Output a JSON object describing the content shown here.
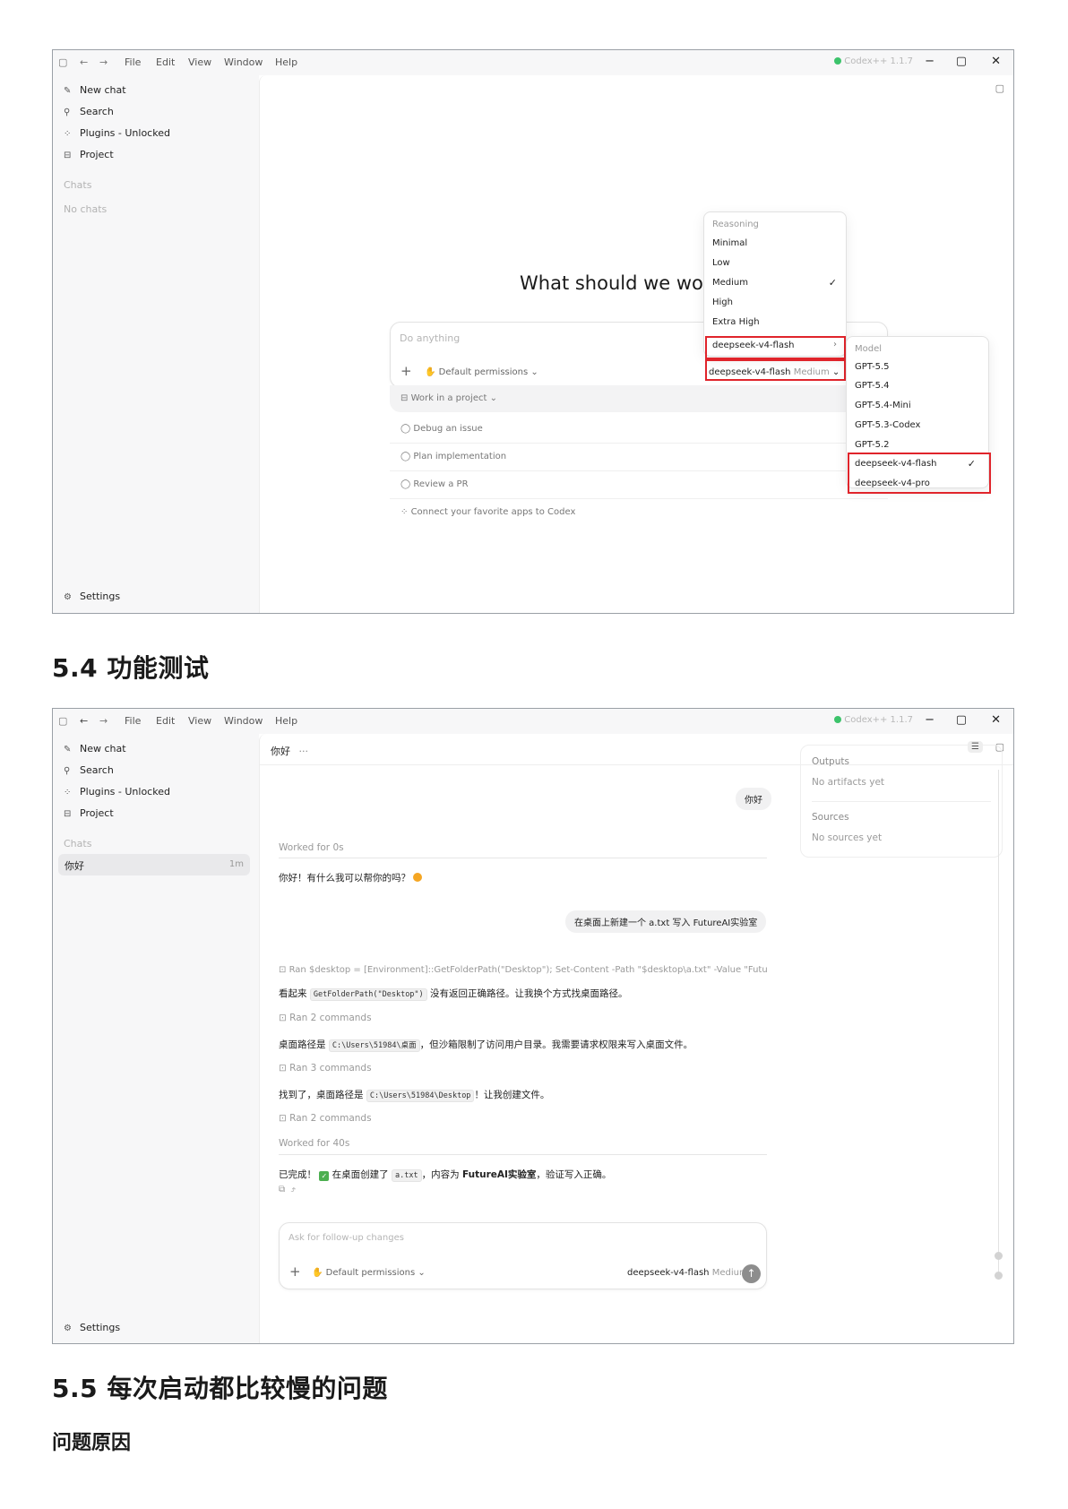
{
  "window": {
    "menu": [
      "File",
      "Edit",
      "View",
      "Window",
      "Help"
    ],
    "app_badge": "Codex++ 1.1.7"
  },
  "sidebar": {
    "new_chat": "New chat",
    "search": "Search",
    "plugins": "Plugins - Unlocked",
    "project": "Project",
    "chats_label": "Chats",
    "no_chats": "No chats",
    "settings": "Settings",
    "chat_item_title": "你好",
    "chat_item_age": "1m"
  },
  "screen1": {
    "hero": "What should we wor",
    "composer_placeholder": "Do anything",
    "permissions": "Default permissions",
    "model_pill_name": "deepseek-v4-flash",
    "model_pill_level": "Medium",
    "work_in_project": "Work in a project",
    "suggestions": [
      "Debug an issue",
      "Plan implementation",
      "Review a PR",
      "Connect your favorite apps to Codex"
    ],
    "reasoning_header": "Reasoning",
    "reasoning_options": [
      "Minimal",
      "Low",
      "Medium",
      "High",
      "Extra High"
    ],
    "reasoning_selected": "Medium",
    "model_entry": "deepseek-v4-flash",
    "model_header": "Model",
    "model_options": [
      "GPT-5.5",
      "GPT-5.4",
      "GPT-5.4-Mini",
      "GPT-5.3-Codex",
      "GPT-5.2",
      "deepseek-v4-flash",
      "deepseek-v4-pro"
    ],
    "model_selected": "deepseek-v4-flash"
  },
  "heading_54": "5.4 功能测试",
  "screen2": {
    "chat_title": "你好",
    "user_msg_1": "你好",
    "worked_1": "Worked for 0s",
    "reply_1": "你好！有什么我可以帮你的吗？",
    "user_msg_2": "在桌面上新建一个 a.txt 写入 FutureAI实验室",
    "ran_1": "Ran $desktop = [Environment]::GetFolderPath(\"Desktop\"); Set-Content -Path \"$desktop\\a.txt\" -Value \"FutureAI...",
    "line_1_pre": "看起来 ",
    "line_1_code": "GetFolderPath(\"Desktop\")",
    "line_1_post": " 没有返回正确路径。让我换个方式找桌面路径。",
    "ran_2": "Ran 2 commands",
    "line_2_pre": "桌面路径是 ",
    "line_2_code": "C:\\Users\\51984\\桌面",
    "line_2_post": "，但沙箱限制了访问用户目录。我需要请求权限来写入桌面文件。",
    "ran_3": "Ran 3 commands",
    "line_3_pre": "找到了，桌面路径是 ",
    "line_3_code": "C:\\Users\\51984\\Desktop",
    "line_3_post": "！让我创建文件。",
    "ran_4": "Ran 2 commands",
    "worked_2": "Worked for 40s",
    "done_pre": "已完成！",
    "done_mid": " 在桌面创建了 ",
    "done_code": "a.txt",
    "done_mid2": "，内容为 ",
    "done_bold": "FutureAI实验室",
    "done_post": "，验证写入正确。",
    "outputs_label": "Outputs",
    "outputs_value": "No artifacts yet",
    "sources_label": "Sources",
    "sources_value": "No sources yet",
    "composer_placeholder": "Ask for follow-up changes",
    "permissions": "Default permissions",
    "model_name": "deepseek-v4-flash",
    "model_level": "Medium"
  },
  "heading_55": "5.5 每次启动都比较慢的问题",
  "subheading": "问题原因"
}
